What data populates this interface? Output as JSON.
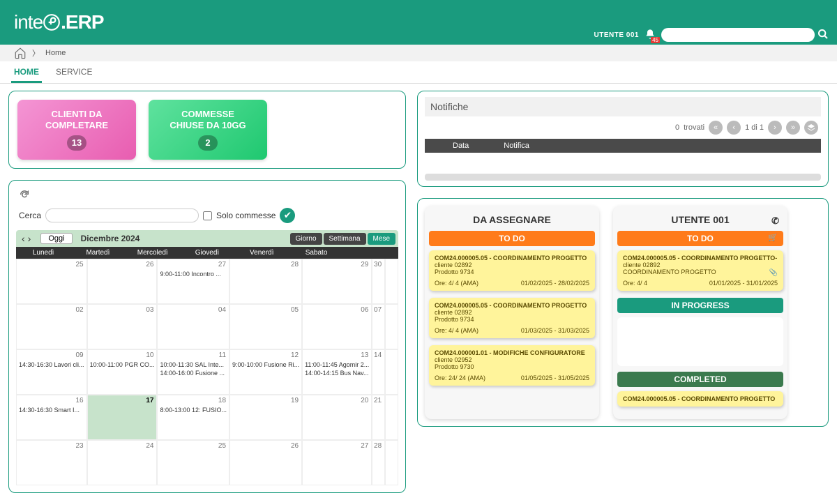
{
  "header": {
    "logo_prefix": "inte",
    "logo_suffix": ".ERP",
    "user": "UTENTE 001",
    "notif_count": "45",
    "search_placeholder": ""
  },
  "breadcrumb": {
    "home": "Home"
  },
  "tabs": {
    "home": "HOME",
    "service": "SERVICE"
  },
  "cards": {
    "clienti_line1": "CLIENTI DA",
    "clienti_line2": "COMPLETARE",
    "clienti_count": "13",
    "commesse_line1": "COMMESSE",
    "commesse_line2": "CHIUSE DA 10GG",
    "commesse_count": "2"
  },
  "calendar": {
    "search_label": "Cerca",
    "solo_commesse": "Solo commesse",
    "today_btn": "Oggi",
    "title": "Dicembre 2024",
    "view_day": "Giorno",
    "view_week": "Settimana",
    "view_month": "Mese",
    "dow": [
      "Lunedì",
      "Martedì",
      "Mercoledì",
      "Giovedì",
      "Venerdì",
      "Sabato",
      ""
    ],
    "weeks": [
      [
        {
          "n": "25",
          "ev": []
        },
        {
          "n": "26",
          "ev": []
        },
        {
          "n": "27",
          "ev": [
            "9:00-11:00 Incontro ..."
          ]
        },
        {
          "n": "28",
          "ev": []
        },
        {
          "n": "29",
          "ev": []
        },
        {
          "n": "30",
          "ev": []
        },
        {
          "n": "",
          "ev": []
        }
      ],
      [
        {
          "n": "02",
          "ev": []
        },
        {
          "n": "03",
          "ev": []
        },
        {
          "n": "04",
          "ev": []
        },
        {
          "n": "05",
          "ev": []
        },
        {
          "n": "06",
          "ev": []
        },
        {
          "n": "07",
          "ev": []
        },
        {
          "n": "",
          "ev": []
        }
      ],
      [
        {
          "n": "09",
          "ev": [
            "14:30-16:30 Lavori cli..."
          ]
        },
        {
          "n": "10",
          "ev": [
            "10:00-11:00 PGR CO..."
          ]
        },
        {
          "n": "11",
          "ev": [
            "10:00-11:30 SAL Inte...",
            "14:00-16:00 Fusione ..."
          ]
        },
        {
          "n": "12",
          "ev": [
            "9:00-10:00 Fusione Ri..."
          ]
        },
        {
          "n": "13",
          "ev": [
            "11:00-11:45 Agomir 2...",
            "14:00-14:15 Bus Nav..."
          ]
        },
        {
          "n": "14",
          "ev": []
        },
        {
          "n": "",
          "ev": []
        }
      ],
      [
        {
          "n": "16",
          "ev": [
            "14:30-16:30 Smart I..."
          ]
        },
        {
          "n": "17",
          "ev": [],
          "today": true,
          "bold": true
        },
        {
          "n": "18",
          "ev": [
            "8:00-13:00 12: FUSIO..."
          ]
        },
        {
          "n": "19",
          "ev": []
        },
        {
          "n": "20",
          "ev": []
        },
        {
          "n": "21",
          "ev": []
        },
        {
          "n": "",
          "ev": []
        }
      ],
      [
        {
          "n": "23",
          "ev": []
        },
        {
          "n": "24",
          "ev": []
        },
        {
          "n": "25",
          "ev": []
        },
        {
          "n": "26",
          "ev": []
        },
        {
          "n": "27",
          "ev": []
        },
        {
          "n": "28",
          "ev": []
        },
        {
          "n": "",
          "ev": []
        }
      ]
    ]
  },
  "notif": {
    "title": "Notifiche",
    "found_count": "0",
    "found_label": "trovati",
    "page_text": "1 di  1",
    "col_data": "Data",
    "col_notifica": "Notifica"
  },
  "kanban": {
    "col1_title": "DA ASSEGNARE",
    "col2_title": "UTENTE 001",
    "status_todo": "TO DO",
    "status_inprogress": "IN PROGRESS",
    "status_completed": "COMPLETED",
    "col1_cards": [
      {
        "title": "COM24.000005.05 - COORDINAMENTO PROGETTO",
        "l1": "cliente 02892",
        "l2": "Prodotto 9734",
        "ore": "Ore: 4/ 4 (AMA)",
        "dates": "01/02/2025 - 28/02/2025"
      },
      {
        "title": "COM24.000005.05 - COORDINAMENTO PROGETTO",
        "l1": "cliente 02892",
        "l2": "Prodotto 9734",
        "ore": "Ore: 4/ 4 (AMA)",
        "dates": "01/03/2025 - 31/03/2025"
      },
      {
        "title": "COM24.000001.01 - MODIFICHE CONFIGURATORE",
        "l1": "cliente 02952",
        "l2": "Prodotto 9730",
        "ore": "Ore: 24/ 24 (AMA)",
        "dates": "01/05/2025 - 31/05/2025"
      }
    ],
    "col2_todo": [
      {
        "title": "COM24.000005.05 - COORDINAMENTO PROGETTO-",
        "l1": "cliente 02892",
        "l2": "COORDINAMENTO PROGETTO",
        "ore": "Ore: 4/ 4",
        "dates": "01/01/2025 - 31/01/2025",
        "attach": true
      }
    ],
    "col2_completed": [
      {
        "title": "COM24.000005.05 - COORDINAMENTO PROGETTO",
        "dates": ""
      }
    ]
  }
}
